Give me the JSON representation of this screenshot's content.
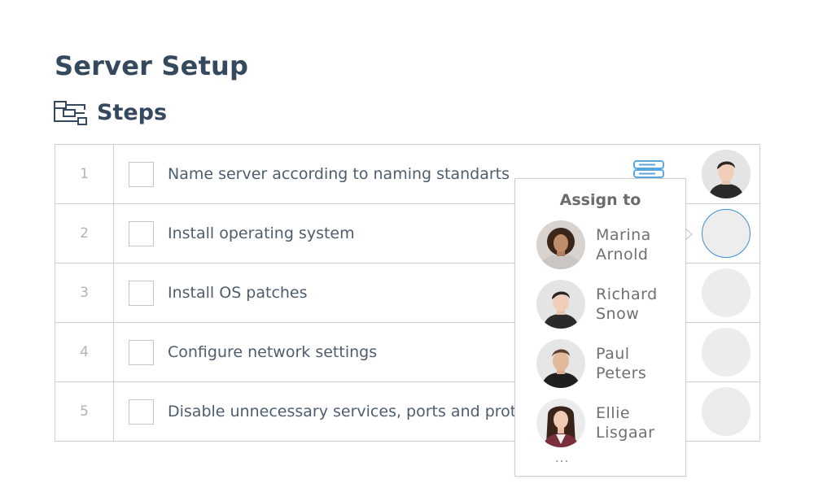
{
  "page": {
    "title": "Server Setup"
  },
  "section": {
    "title": "Steps",
    "icon": "workflow-icon"
  },
  "steps": [
    {
      "number": "1",
      "label": "Name server according to naming standarts",
      "checked": false,
      "assignee": "Richard Snow"
    },
    {
      "number": "2",
      "label": "Install operating system",
      "checked": false,
      "assignee": ""
    },
    {
      "number": "3",
      "label": "Install OS patches",
      "checked": false,
      "assignee": ""
    },
    {
      "number": "4",
      "label": "Configure network settings",
      "checked": false,
      "assignee": ""
    },
    {
      "number": "5",
      "label": "Disable unnecessary services, ports and protocols",
      "checked": false,
      "assignee": ""
    }
  ],
  "popover": {
    "title": "Assign to",
    "people": [
      {
        "first": "Marina",
        "last": "Arnold"
      },
      {
        "first": "Richard",
        "last": "Snow"
      },
      {
        "first": "Paul",
        "last": "Peters"
      },
      {
        "first": "Ellie",
        "last": "Lisgaar"
      }
    ],
    "more": "..."
  },
  "colors": {
    "heading": "#34495e",
    "text": "#4e5d6e",
    "border": "#cfcfcf",
    "accent": "#3a8fd6",
    "placeholder": "#ececec"
  }
}
